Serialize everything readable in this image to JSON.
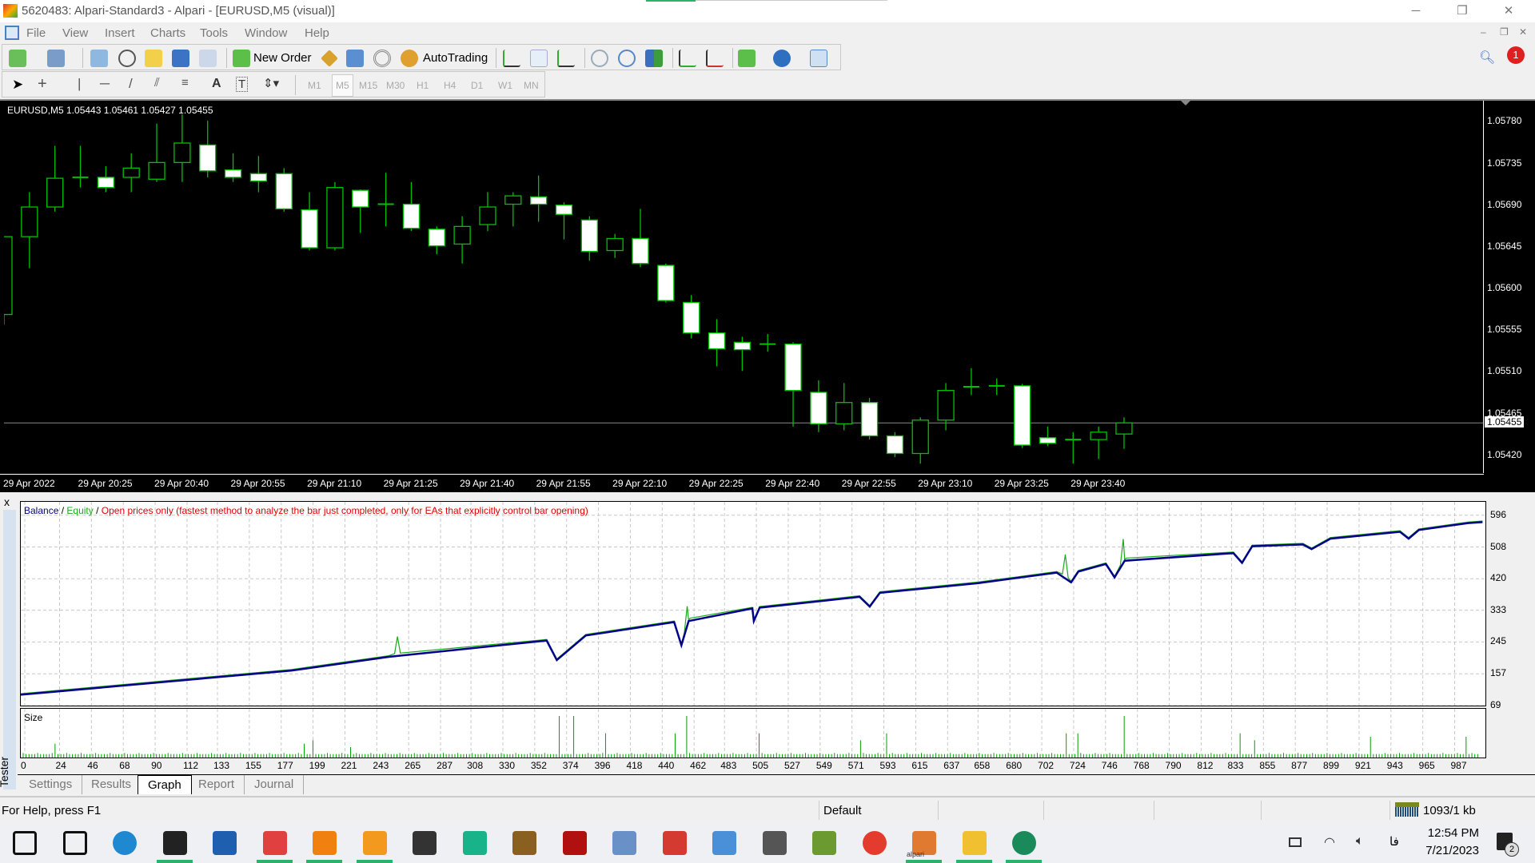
{
  "window": {
    "title": "5620483: Alpari-Standard3 - Alpari - [EURUSD,M5 (visual)]",
    "controls": [
      "minimize",
      "restore",
      "close"
    ]
  },
  "menu": [
    "File",
    "View",
    "Insert",
    "Charts",
    "Tools",
    "Window",
    "Help"
  ],
  "toolbar": {
    "new_order": "New Order",
    "autotrading": "AutoTrading"
  },
  "timeframes": [
    "M1",
    "M5",
    "M15",
    "M30",
    "H1",
    "H4",
    "D1",
    "W1",
    "MN"
  ],
  "active_timeframe": "M5",
  "colors": {
    "chart_bg": "#000000",
    "candle_outline": "#00c000",
    "bear_body": "#ffffff",
    "bull_body": "#000000",
    "balance": "#00008b",
    "equity": "#1aaa1a",
    "mode_text": "#e00000",
    "size_bars": "#00a000"
  },
  "chart_data": [
    {
      "type": "candlestick",
      "symbol_header": "EURUSD,M5  1.05443 1.05461 1.05427 1.05455",
      "ylim": [
        1.054,
        1.05801
      ],
      "price_ticks": [
        "1.05780",
        "1.05735",
        "1.05690",
        "1.05645",
        "1.05600",
        "1.05555",
        "1.05510",
        "1.05465",
        "1.05420"
      ],
      "current_price": "1.05455",
      "date_ticks": [
        "29 Apr 2022",
        "29 Apr 20:25",
        "29 Apr 20:40",
        "29 Apr 20:55",
        "29 Apr 21:10",
        "29 Apr 21:25",
        "29 Apr 21:40",
        "29 Apr 21:55",
        "29 Apr 22:10",
        "29 Apr 22:25",
        "29 Apr 22:40",
        "29 Apr 22:55",
        "29 Apr 23:10",
        "29 Apr 23:25",
        "29 Apr 23:40"
      ],
      "candles_ohlc": [
        [
          1.05572,
          1.0558,
          1.05561,
          1.05656
        ],
        [
          1.05656,
          1.05704,
          1.05622,
          1.05688
        ],
        [
          1.05688,
          1.05754,
          1.05683,
          1.05719
        ],
        [
          1.0572,
          1.05754,
          1.05709,
          1.0572
        ],
        [
          1.0572,
          1.05732,
          1.05704,
          1.05709
        ],
        [
          1.0572,
          1.05746,
          1.05704,
          1.0573
        ],
        [
          1.05718,
          1.05778,
          1.05715,
          1.05736
        ],
        [
          1.05736,
          1.05788,
          1.05715,
          1.05757
        ],
        [
          1.05755,
          1.05781,
          1.0572,
          1.05727
        ],
        [
          1.05728,
          1.05746,
          1.05715,
          1.0572
        ],
        [
          1.05724,
          1.05743,
          1.05704,
          1.05716
        ],
        [
          1.05724,
          1.0573,
          1.05683,
          1.05686
        ],
        [
          1.05685,
          1.05704,
          1.05641,
          1.05644
        ],
        [
          1.05644,
          1.05715,
          1.05641,
          1.05709
        ],
        [
          1.05706,
          1.05707,
          1.0566,
          1.05688
        ],
        [
          1.05691,
          1.05725,
          1.05667,
          1.05691
        ],
        [
          1.05691,
          1.05715,
          1.05662,
          1.05665
        ],
        [
          1.05664,
          1.05667,
          1.05637,
          1.05646
        ],
        [
          1.05648,
          1.05678,
          1.05627,
          1.05667
        ],
        [
          1.05669,
          1.05704,
          1.05662,
          1.05688
        ],
        [
          1.05691,
          1.05704,
          1.05667,
          1.057
        ],
        [
          1.05699,
          1.05722,
          1.05672,
          1.05691
        ],
        [
          1.0569,
          1.05693,
          1.05653,
          1.0568
        ],
        [
          1.05674,
          1.05678,
          1.0563,
          1.0564
        ],
        [
          1.05641,
          1.05659,
          1.05633,
          1.05654
        ],
        [
          1.05654,
          1.05686,
          1.05623,
          1.05627
        ],
        [
          1.05625,
          1.05627,
          1.05585,
          1.05587
        ],
        [
          1.05585,
          1.05593,
          1.05546,
          1.05552
        ],
        [
          1.05552,
          1.05567,
          1.05516,
          1.05535
        ],
        [
          1.05542,
          1.05548,
          1.05511,
          1.05534
        ],
        [
          1.0554,
          1.05551,
          1.05532,
          1.0554
        ],
        [
          1.0554,
          1.05542,
          1.05451,
          1.0549
        ],
        [
          1.05488,
          1.05501,
          1.05445,
          1.05454
        ],
        [
          1.05454,
          1.05498,
          1.05447,
          1.05477
        ],
        [
          1.05477,
          1.05482,
          1.05437,
          1.05441
        ],
        [
          1.05441,
          1.05445,
          1.05418,
          1.05422
        ],
        [
          1.05422,
          1.05461,
          1.05411,
          1.05458
        ],
        [
          1.05458,
          1.05498,
          1.05447,
          1.0549
        ],
        [
          1.05494,
          1.05514,
          1.05485,
          1.05494
        ],
        [
          1.05495,
          1.05503,
          1.05485,
          1.05495
        ],
        [
          1.05495,
          1.05497,
          1.05428,
          1.05431
        ],
        [
          1.05439,
          1.05451,
          1.0543,
          1.05433
        ],
        [
          1.05437,
          1.05445,
          1.05411,
          1.05437
        ],
        [
          1.05437,
          1.05451,
          1.05416,
          1.05445
        ],
        [
          1.05443,
          1.05461,
          1.05427,
          1.05455
        ]
      ]
    },
    {
      "type": "line",
      "legend": {
        "balance": "Balance",
        "equity": "Equity",
        "sep": " / ",
        "mode": "Open prices only (fastest method to analyze the bar just completed, only for EAs that explicitly control bar opening)"
      },
      "ylim": [
        69,
        633
      ],
      "xlim": [
        0,
        1011
      ],
      "grid": true,
      "y_ticks": [
        "596",
        "508",
        "420",
        "333",
        "245",
        "157",
        "69"
      ],
      "x_ticks": [
        "0",
        "24",
        "46",
        "68",
        "90",
        "112",
        "133",
        "155",
        "177",
        "199",
        "221",
        "243",
        "265",
        "287",
        "308",
        "330",
        "352",
        "374",
        "396",
        "418",
        "440",
        "462",
        "483",
        "505",
        "527",
        "549",
        "571",
        "593",
        "615",
        "637",
        "658",
        "680",
        "702",
        "724",
        "746",
        "768",
        "790",
        "812",
        "833",
        "855",
        "877",
        "899",
        "921",
        "943",
        "965",
        "987"
      ],
      "balance": [
        [
          0,
          99
        ],
        [
          187,
          166
        ],
        [
          254,
          204
        ],
        [
          363,
          249
        ],
        [
          370,
          195
        ],
        [
          390,
          263
        ],
        [
          451,
          300
        ],
        [
          456,
          236
        ],
        [
          461,
          303
        ],
        [
          505,
          338
        ],
        [
          506,
          303
        ],
        [
          510,
          340
        ],
        [
          579,
          370
        ],
        [
          586,
          343
        ],
        [
          593,
          381
        ],
        [
          661,
          408
        ],
        [
          715,
          437
        ],
        [
          725,
          410
        ],
        [
          730,
          440
        ],
        [
          749,
          461
        ],
        [
          755,
          424
        ],
        [
          762,
          470
        ],
        [
          837,
          491
        ],
        [
          843,
          464
        ],
        [
          850,
          510
        ],
        [
          885,
          515
        ],
        [
          891,
          502
        ],
        [
          904,
          531
        ],
        [
          952,
          550
        ],
        [
          958,
          531
        ],
        [
          965,
          555
        ],
        [
          999,
          574
        ],
        [
          1009,
          577
        ]
      ],
      "equity_spikes": [
        [
          260,
          257
        ],
        [
          460,
          341
        ],
        [
          721,
          484
        ],
        [
          761,
          527
        ]
      ]
    },
    {
      "type": "bar",
      "label": "Size",
      "base": 1,
      "spikes": [
        [
          22,
          4
        ],
        [
          194,
          4
        ],
        [
          200,
          5
        ],
        [
          227,
          3
        ],
        [
          371,
          12
        ],
        [
          381,
          12
        ],
        [
          402,
          7
        ],
        [
          451,
          7
        ],
        [
          458,
          12
        ],
        [
          508,
          7
        ],
        [
          579,
          5
        ],
        [
          596,
          7
        ],
        [
          720,
          7
        ],
        [
          728,
          7
        ],
        [
          761,
          12
        ],
        [
          840,
          7
        ],
        [
          850,
          5
        ],
        [
          931,
          6
        ],
        [
          996,
          6
        ]
      ]
    }
  ],
  "tester": {
    "side_label": "Tester",
    "close": "x",
    "tabs": [
      "Settings",
      "Results",
      "Graph",
      "Report",
      "Journal"
    ],
    "active_tab": "Graph"
  },
  "status": {
    "help": "For Help, press F1",
    "profile": "Default",
    "traffic": "1093/1 kb"
  },
  "taskbar": {
    "apps": [
      "windows-start",
      "search",
      "edge",
      "sticky-notes",
      "store",
      "snipping-tool",
      "vlc",
      "media-player",
      "audio-app",
      "pushbullet",
      "gimp-monkey",
      "filezilla",
      "on-screen-keyboard",
      "gmail",
      "remote-desktop",
      "settings",
      "notepad-plus",
      "chrome",
      "alpari",
      "file-explorer",
      "chrome-fx"
    ],
    "alpari_label": "alpari",
    "time": "12:54 PM",
    "date": "7/21/2023",
    "notifications": "2",
    "lang": "فا"
  }
}
